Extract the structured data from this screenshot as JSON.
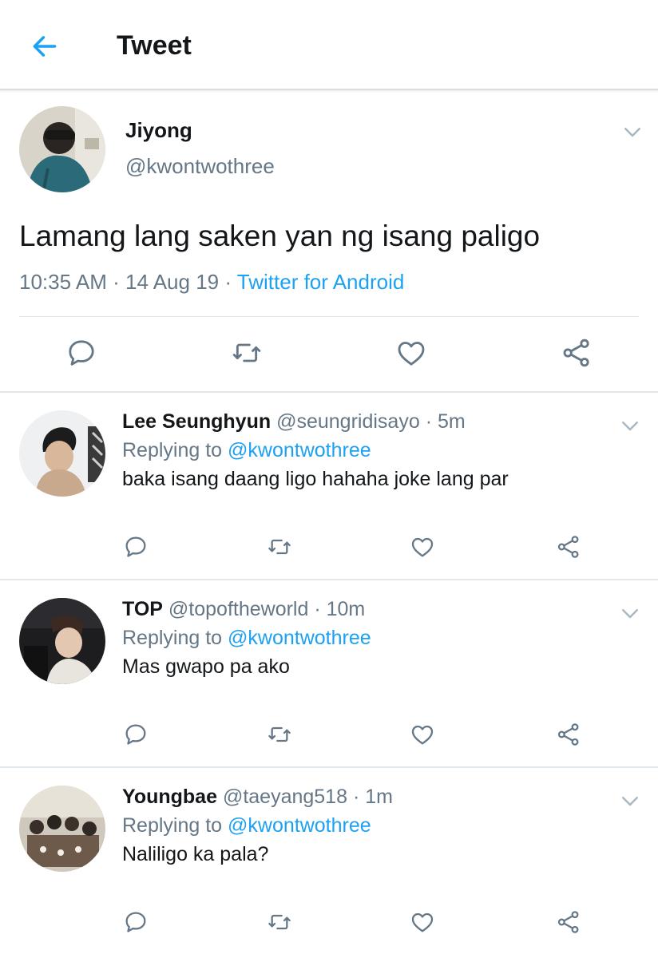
{
  "colors": {
    "accent": "#1da1f2",
    "text": "#14171a",
    "secondary": "#657786",
    "divider": "#e1e8ed"
  },
  "header": {
    "title": "Tweet",
    "back_icon": "arrow-left-icon"
  },
  "tweet": {
    "name": "Jiyong",
    "handle": "@kwontwothree",
    "text": "Lamang lang saken yan ng isang paligo",
    "time": "10:35 AM",
    "date": "14 Aug 19",
    "source": "Twitter for Android",
    "separator": "·",
    "actions": [
      "reply-icon",
      "retweet-icon",
      "like-icon",
      "share-icon"
    ]
  },
  "replies": [
    {
      "name": "Lee Seunghyun",
      "handle": "@seungridisayo",
      "time": "5m",
      "replying_label": "Replying to",
      "replying_to": "@kwontwothree",
      "text": "baka isang daang ligo hahaha joke lang par"
    },
    {
      "name": "TOP",
      "handle": "@topoftheworld",
      "time": "10m",
      "replying_label": "Replying to",
      "replying_to": "@kwontwothree",
      "text": "Mas gwapo pa ako"
    },
    {
      "name": "Youngbae",
      "handle": "@taeyang518",
      "time": "1m",
      "replying_label": "Replying to",
      "replying_to": "@kwontwothree",
      "text": "Naliligo ka pala?"
    }
  ]
}
